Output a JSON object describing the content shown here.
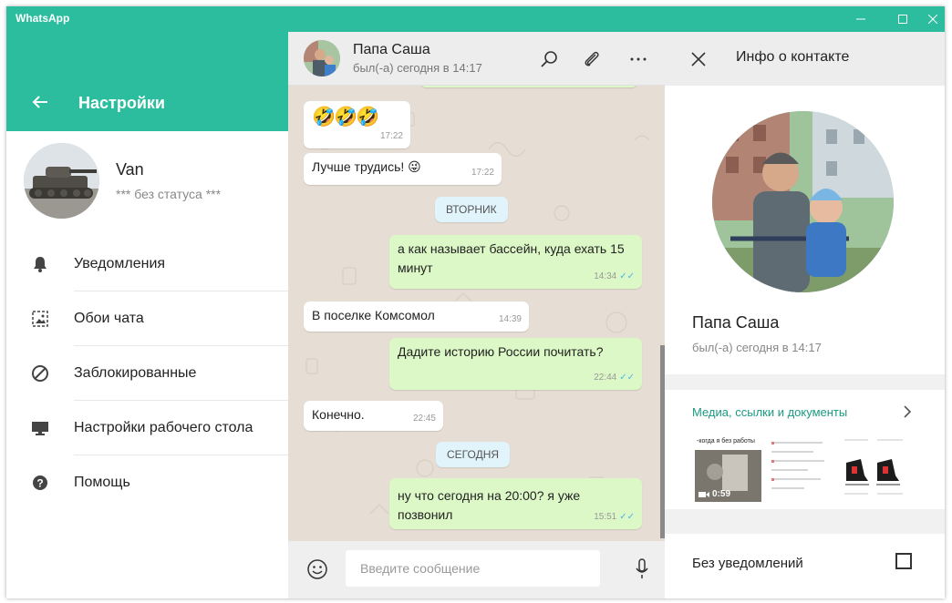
{
  "window": {
    "app_title": "WhatsApp"
  },
  "settings": {
    "title": "Настройки",
    "profile": {
      "name": "Van",
      "status": "*** без статуса ***"
    },
    "menu": [
      {
        "label": "Уведомления",
        "icon": "bell-icon"
      },
      {
        "label": "Обои чата",
        "icon": "wallpaper-icon"
      },
      {
        "label": "Заблокированные",
        "icon": "blocked-icon"
      },
      {
        "label": "Настройки рабочего стола",
        "icon": "monitor-icon"
      },
      {
        "label": "Помощь",
        "icon": "help-icon"
      }
    ]
  },
  "chat": {
    "contact_name": "Папа Саша",
    "contact_status": "был(-а) сегодня в 14:17",
    "messages": [
      {
        "dir": "in",
        "text": "🤣🤣🤣",
        "time": "17:22"
      },
      {
        "dir": "in",
        "text": "Лучше трудись! 😜",
        "time": "17:22"
      },
      {
        "day": "ВТОРНИК"
      },
      {
        "dir": "out",
        "text": "а как называет бассейн, куда ехать 15 минут",
        "time": "14:34",
        "ticks": "✓✓"
      },
      {
        "dir": "in",
        "text": "В поселке Комсомол",
        "time": "14:39"
      },
      {
        "dir": "out",
        "text": "Дадите историю России почитать?",
        "time": "22:44",
        "ticks": "✓✓"
      },
      {
        "dir": "in",
        "text": "Конечно.",
        "time": "22:45"
      },
      {
        "day": "СЕГОДНЯ"
      },
      {
        "dir": "out",
        "text": "ну что сегодня на 20:00? я уже позвонил",
        "time": "15:51",
        "ticks": "✓✓"
      }
    ],
    "input_placeholder": "Введите сообщение"
  },
  "info": {
    "title": "Инфо о контакте",
    "name": "Папа Саша",
    "status": "был(-а) сегодня в 14:17",
    "media_title": "Медиа, ссылки и документы",
    "media_thumbs": [
      {
        "caption": "-когда я без работы",
        "duration": "0:59"
      },
      {
        "caption": ""
      },
      {
        "caption": ""
      }
    ],
    "mute_label": "Без уведомлений",
    "mute_checked": false
  },
  "colors": {
    "accent": "#2bbd9d",
    "outgoing_bubble": "#dcf8c6",
    "incoming_bubble": "#ffffff",
    "chat_bg": "#e6ded4",
    "link": "#1b9a82",
    "read_ticks": "#4fb6ec"
  }
}
